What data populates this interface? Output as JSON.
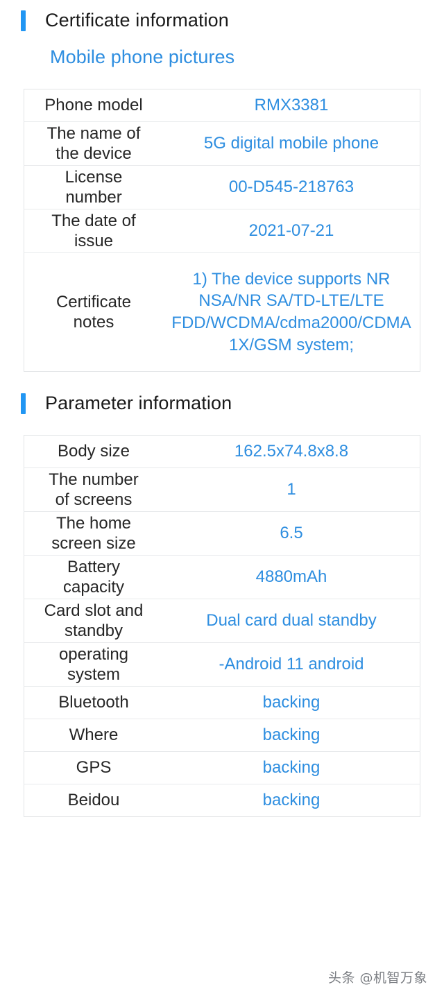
{
  "theme": {
    "accent_color": "#2196f3",
    "link_color": "#2e8ee0",
    "value_color": "#2e8ee0",
    "label_color": "#262626",
    "border_color": "#e2e4e6",
    "background": "#ffffff"
  },
  "sections": [
    {
      "id": "certificate-information",
      "heading": "Certificate information",
      "sub_link": "Mobile phone pictures",
      "rows": [
        {
          "label": "Phone model",
          "value": "RMX3381"
        },
        {
          "label": "The name of\nthe device",
          "value": "5G digital mobile phone"
        },
        {
          "label": "License\nnumber",
          "value": "00-D545-218763"
        },
        {
          "label": "The date of\nissue",
          "value": "2021-07-21"
        },
        {
          "label": "Certificate\nnotes",
          "value": "1) The device supports NR NSA/NR SA/TD-LTE/LTE FDD/WCDMA/cdma2000/CDMA 1X/GSM system;"
        }
      ]
    },
    {
      "id": "parameter-information",
      "heading": "Parameter information",
      "rows": [
        {
          "label": "Body size",
          "value": "162.5x74.8x8.8"
        },
        {
          "label": "The number\nof screens",
          "value": "1"
        },
        {
          "label": "The home\nscreen size",
          "value": "6.5"
        },
        {
          "label": "Battery\ncapacity",
          "value": "4880mAh"
        },
        {
          "label": "Card slot and\nstandby",
          "value": "Dual card dual standby"
        },
        {
          "label": "operating\nsystem",
          "value": "-Android 11 android"
        },
        {
          "label": "Bluetooth",
          "value": "backing"
        },
        {
          "label": "Where",
          "value": "backing"
        },
        {
          "label": "GPS",
          "value": "backing"
        },
        {
          "label": "Beidou",
          "value": "backing"
        }
      ]
    }
  ],
  "watermark": "头条 @机智万象"
}
